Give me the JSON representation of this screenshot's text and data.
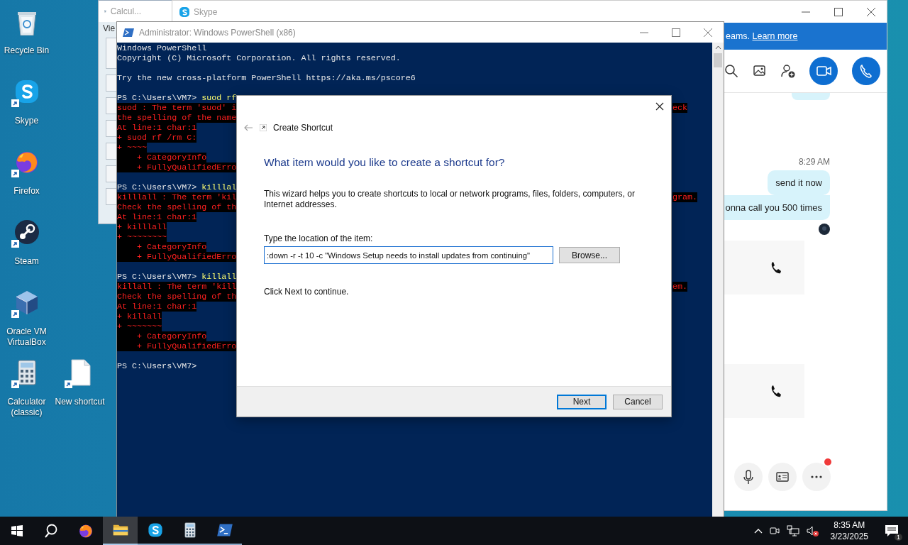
{
  "desktop_icons": [
    {
      "label": "Recycle Bin",
      "kind": "recycle",
      "shortcut": false
    },
    {
      "label": "Skype",
      "kind": "chat",
      "shortcut": true
    },
    {
      "label": "Firefox",
      "kind": "browser",
      "shortcut": true
    },
    {
      "label": "Steam",
      "kind": "game",
      "shortcut": true
    },
    {
      "label": "Oracle VM VirtualBox",
      "kind": "cube",
      "shortcut": true
    },
    {
      "label": "Calculator (classic)",
      "kind": "calculator",
      "shortcut": true
    },
    {
      "label": "New shortcut",
      "kind": "file",
      "shortcut": true
    }
  ],
  "calculator_window": {
    "title": "Calcul...",
    "menu_text": "Vie"
  },
  "skype_window": {
    "title": "Skype",
    "banner_text": "eams.",
    "banner_link": "Learn more",
    "message_time": "8:29 AM",
    "messages": [
      "send it now",
      "onna call you 500 times"
    ],
    "more_badge": true
  },
  "powershell_window": {
    "title": "Administrator: Windows PowerShell (x86)",
    "lines": [
      {
        "kind": "plain",
        "text": "Windows PowerShell"
      },
      {
        "kind": "plain",
        "text": "Copyright (C) Microsoft Corporation. All rights reserved."
      },
      {
        "kind": "blank"
      },
      {
        "kind": "plain",
        "text": "Try the new cross-platform PowerShell https://aka.ms/pscore6"
      },
      {
        "kind": "blank"
      },
      {
        "kind": "prompt",
        "prompt": "PS C:\\Users\\VM7>",
        "command": "suod rf"
      },
      {
        "kind": "error",
        "text": "suod : The term 'suod' i",
        "tail": "eck"
      },
      {
        "kind": "error",
        "text": "the spelling of the name"
      },
      {
        "kind": "error",
        "text": "At line:1 char:1"
      },
      {
        "kind": "error",
        "text": "+ suod rf /rm C:"
      },
      {
        "kind": "error",
        "text": "+ ~~~~"
      },
      {
        "kind": "error",
        "text": "    + CategoryInfo"
      },
      {
        "kind": "error",
        "text": "    + FullyQualifiedErro"
      },
      {
        "kind": "blank"
      },
      {
        "kind": "prompt",
        "prompt": "PS C:\\Users\\VM7>",
        "command": "killlal"
      },
      {
        "kind": "error",
        "text": "killlall : The term 'kil",
        "tail": "gram."
      },
      {
        "kind": "error",
        "text": "Check the spelling of th"
      },
      {
        "kind": "error",
        "text": "At line:1 char:1"
      },
      {
        "kind": "error",
        "text": "+ killlall"
      },
      {
        "kind": "error",
        "text": "+ ~~~~~~~~"
      },
      {
        "kind": "error",
        "text": "    + CategoryInfo"
      },
      {
        "kind": "error",
        "text": "    + FullyQualifiedErro"
      },
      {
        "kind": "blank"
      },
      {
        "kind": "prompt",
        "prompt": "PS C:\\Users\\VM7>",
        "command": "killall"
      },
      {
        "kind": "error",
        "text": "killall : The term 'kill",
        "tail": "em."
      },
      {
        "kind": "error",
        "text": "Check the spelling of th"
      },
      {
        "kind": "error",
        "text": "At line:1 char:1"
      },
      {
        "kind": "error",
        "text": "+ killall"
      },
      {
        "kind": "error",
        "text": "+ ~~~~~~~"
      },
      {
        "kind": "error",
        "text": "    + CategoryInfo"
      },
      {
        "kind": "error",
        "text": "    + FullyQualifiedErro"
      },
      {
        "kind": "blank"
      },
      {
        "kind": "prompt",
        "prompt": "PS C:\\Users\\VM7>"
      }
    ]
  },
  "dialog": {
    "title": "Create Shortcut",
    "heading": "What item would you like to create a shortcut for?",
    "description": "This wizard helps you to create shortcuts to local or network programs, files, folders, computers, or Internet addresses.",
    "field_label": "Type the location of the item:",
    "location_value": ":down -r -t 10 -c \"Windows Setup needs to install updates from continuing\"",
    "browse_button": "Browse...",
    "hint": "Click Next to continue.",
    "buttons": [
      {
        "label": "Next",
        "default": true
      },
      {
        "label": "Cancel",
        "default": false
      }
    ]
  },
  "taskbar": {
    "apps": [
      {
        "kind": "browser",
        "running": false,
        "selected": false
      },
      {
        "kind": "folder",
        "running": true,
        "selected": true
      },
      {
        "kind": "chat",
        "running": true,
        "selected": false
      },
      {
        "kind": "calculator",
        "running": true,
        "selected": false
      },
      {
        "kind": "terminal",
        "running": true,
        "selected": false
      }
    ],
    "time": "8:35 AM",
    "date": "3/23/2025",
    "notification_count": "1"
  }
}
